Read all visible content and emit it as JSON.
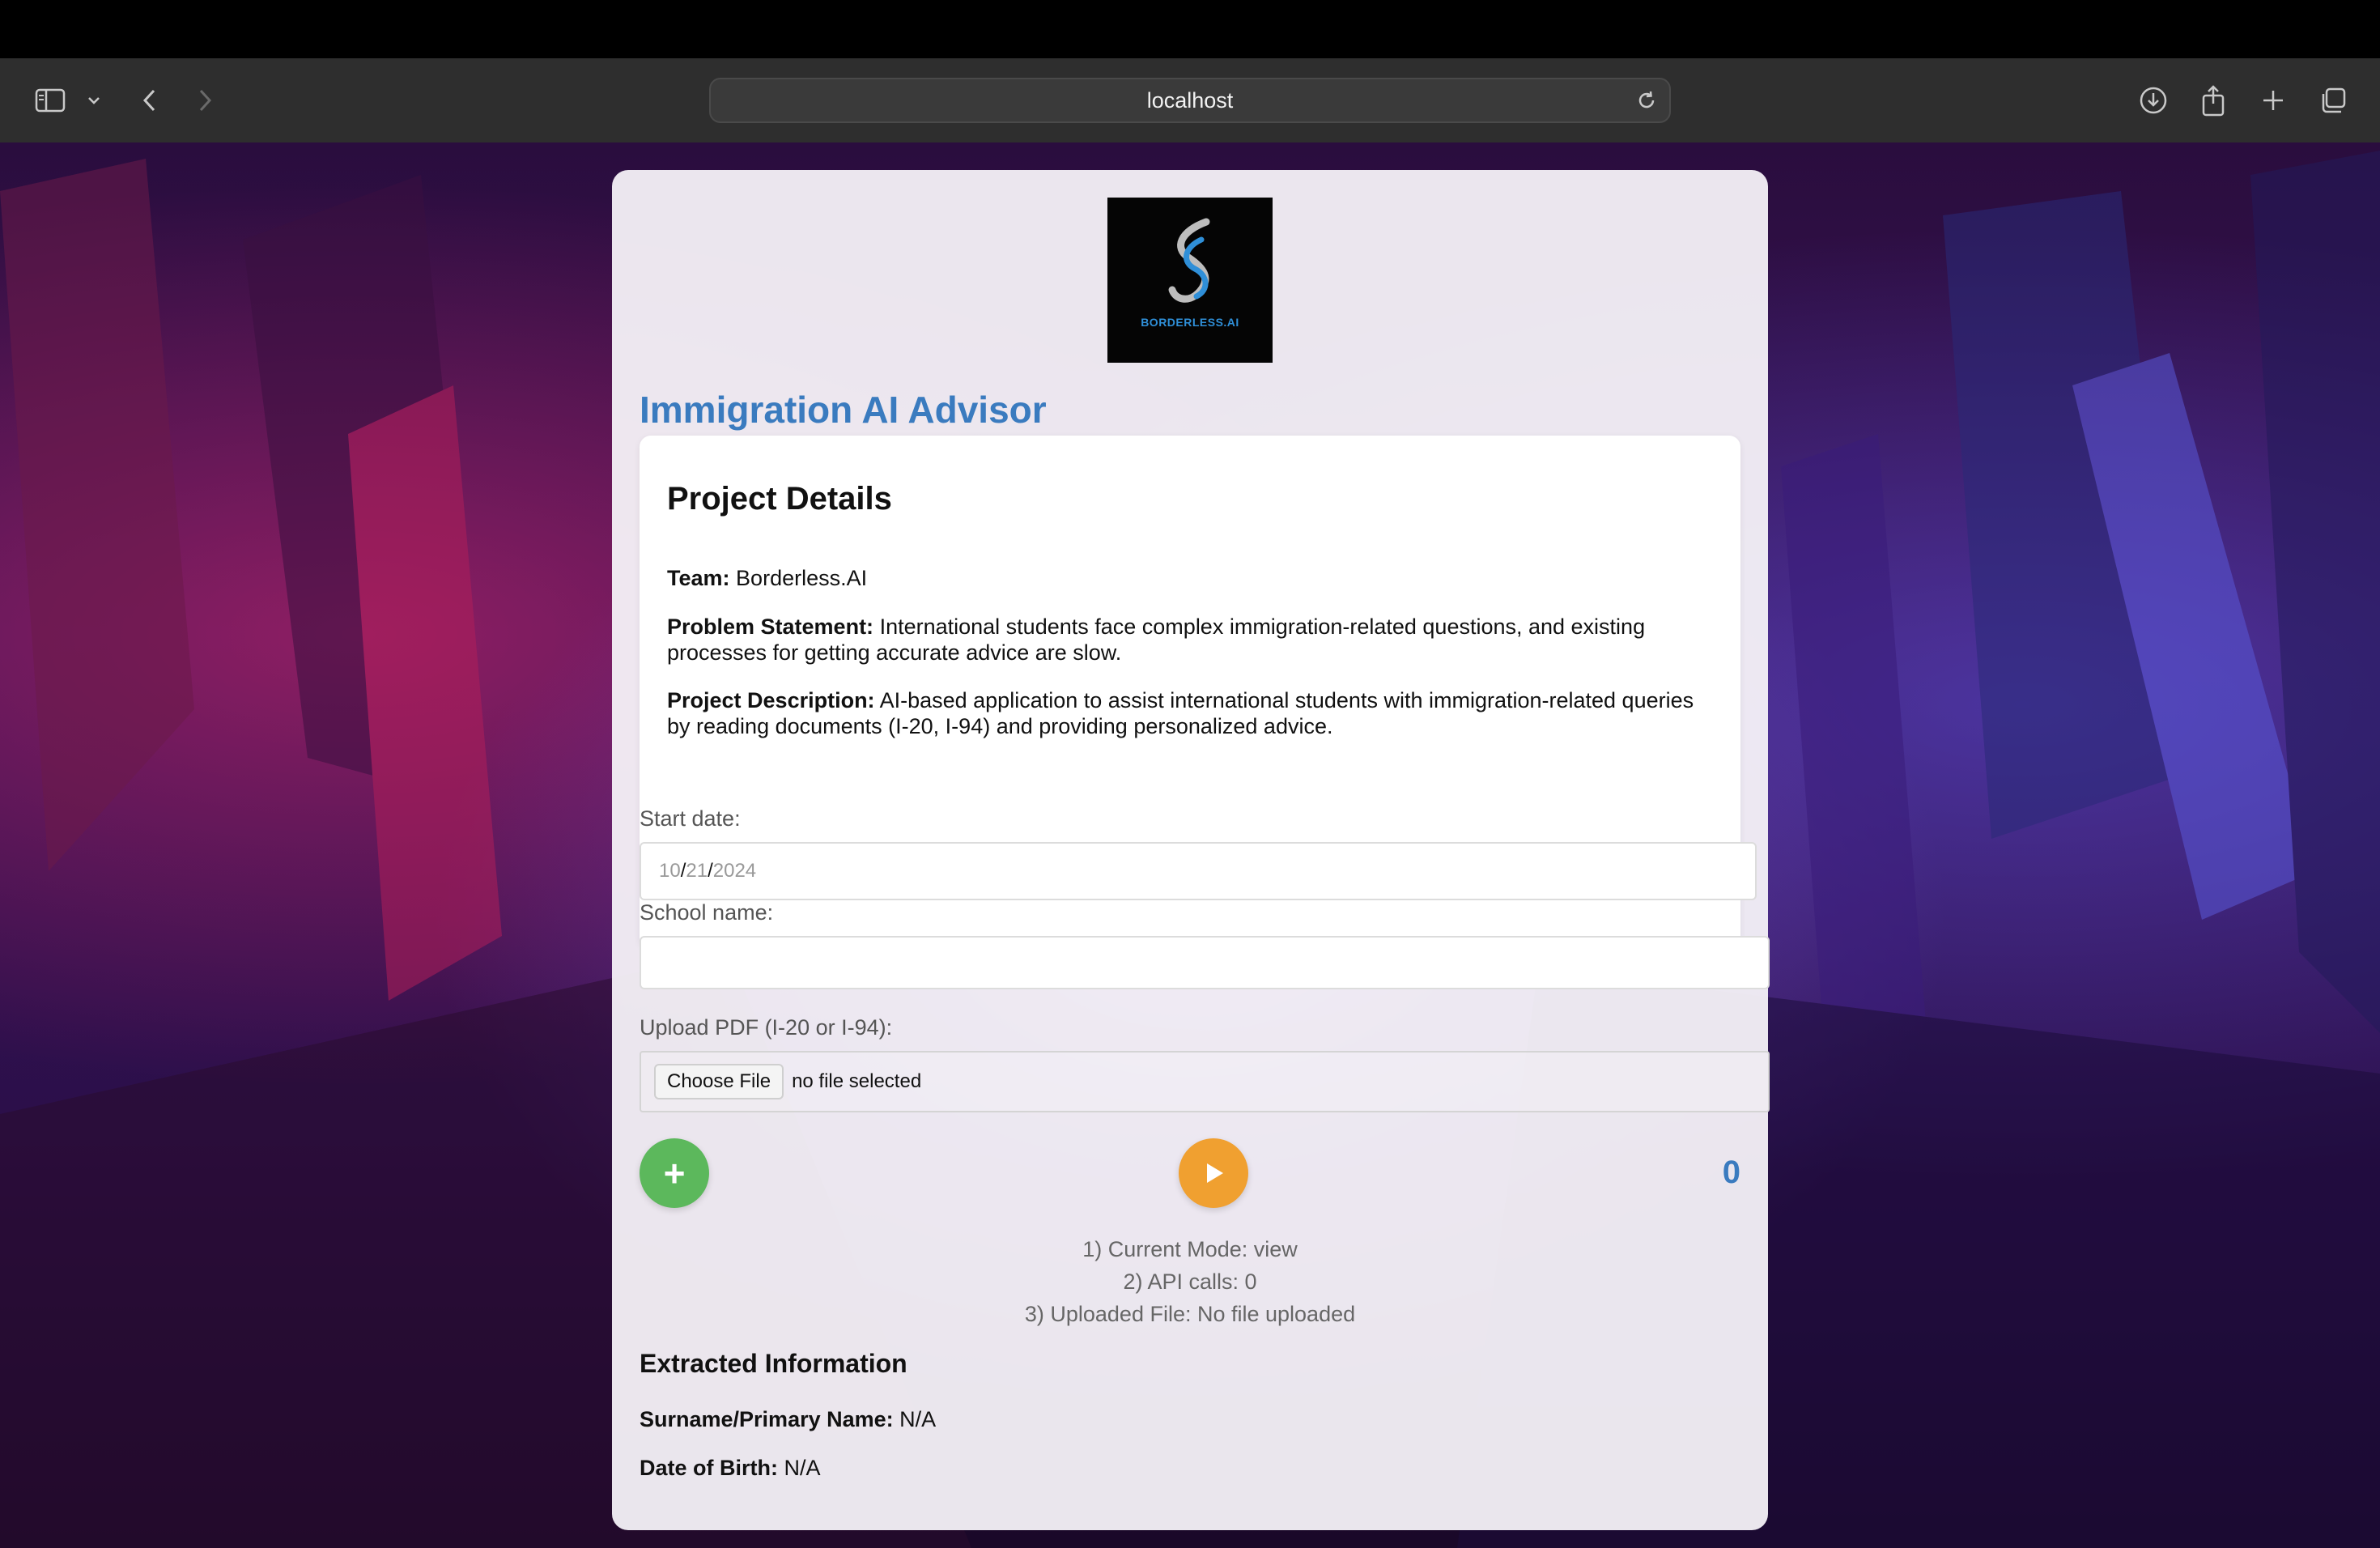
{
  "browser": {
    "url": "localhost"
  },
  "app": {
    "logo_text": "BORDERLESS.AI",
    "title": "Immigration AI Advisor"
  },
  "project_details": {
    "heading": "Project Details",
    "team_label": "Team:",
    "team_value": "Borderless.AI",
    "problem_label": "Problem Statement:",
    "problem_value": "International students face complex immigration-related questions, and existing processes for getting accurate advice are slow.",
    "description_label": "Project Description:",
    "description_value": "AI-based application to assist international students with immigration-related queries by reading documents (I-20, I-94) and providing personalized advice."
  },
  "form": {
    "start_date_label": "Start date:",
    "start_date": {
      "month": "10",
      "day": "21",
      "year": "2024",
      "sep": "/"
    },
    "school_name_label": "School name:",
    "school_name_value": "",
    "upload_label": "Upload PDF (I-20 or I-94):",
    "choose_file_label": "Choose File",
    "file_status": "no file selected"
  },
  "controls": {
    "add_label": "+",
    "counter": "0"
  },
  "status": {
    "line1": "1) Current Mode: view",
    "line2": "2) API calls: 0",
    "line3": "3) Uploaded File: No file uploaded"
  },
  "extracted": {
    "heading": "Extracted Information",
    "surname_label": "Surname/Primary Name:",
    "surname_value": "N/A",
    "dob_label": "Date of Birth:",
    "dob_value": "N/A"
  },
  "colors": {
    "title": "#3a7bbf",
    "add_button": "#5cb85c",
    "play_button": "#f0a030",
    "logo_accent": "#2f8fd8"
  },
  "icons": [
    "sidebar-icon",
    "chevron-down-icon",
    "back-icon",
    "forward-icon",
    "reload-icon",
    "download-icon",
    "share-icon",
    "new-tab-icon",
    "tabs-overview-icon",
    "play-icon"
  ]
}
